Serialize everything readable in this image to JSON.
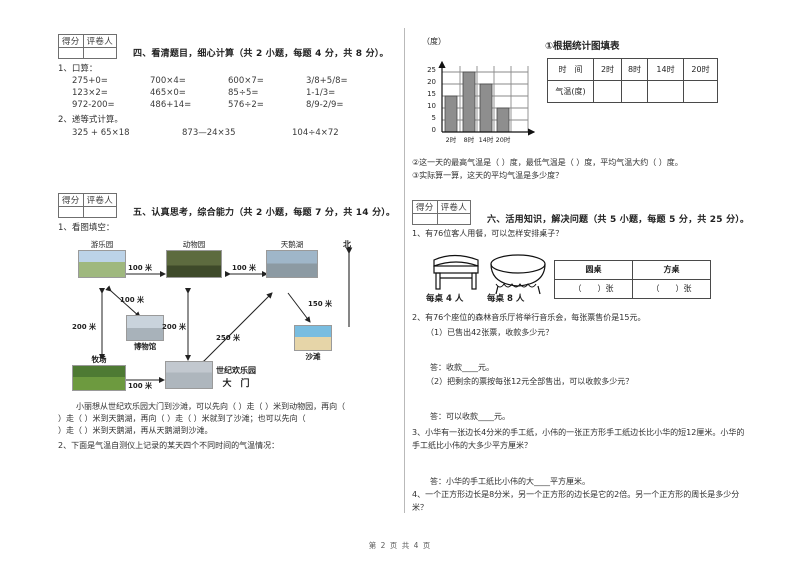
{
  "footer": "第 2 页 共 4 页",
  "score_box": {
    "score_label": "得分",
    "grader_label": "评卷人"
  },
  "section4": {
    "title": "四、看清题目，细心计算（共 2 小题，每题 4 分，共 8 分）。",
    "q1_label": "1、口算：",
    "oral_rows": [
      [
        "275+0=",
        "700×4=",
        "600×7=",
        "3/8+5/8="
      ],
      [
        "123×2=",
        "465×0=",
        "85÷5=",
        "1-1/3="
      ],
      [
        "972-200=",
        "486+14=",
        "576÷2=",
        "8/9-2/9="
      ]
    ],
    "q2_label": "2、递等式计算。",
    "equations": [
      "325 + 65×18",
      "873—24×35",
      "104÷4×72"
    ]
  },
  "section5": {
    "title": "五、认真思考，综合能力（共 2 小题，每题 7 分，共 14 分）。",
    "q1_label": "1、看图填空：",
    "north": "北",
    "map": {
      "nodes": [
        {
          "name": "游乐园"
        },
        {
          "name": "动物园"
        },
        {
          "name": "天鹅湖"
        },
        {
          "name": "博物馆"
        },
        {
          "name": "牧场"
        },
        {
          "name": "世纪欢乐园"
        },
        {
          "name": "大　门"
        },
        {
          "name": "沙滩"
        }
      ],
      "distances": [
        "100 米",
        "100 米",
        "100 米",
        "200 米",
        "200 米",
        "250 米",
        "150 米",
        "100 米"
      ]
    },
    "fill_lines": [
      "小丽想从世纪欢乐园大门到沙滩，可以先向（        ）走（         ）米到动物园，再向（",
      "）走（          ）米到天鹅湖，再向（          ）走（         ）米就到了沙滩；也可以先向（",
      "）走（       ）米到天鹅湖，再从天鹅湖到沙滩。"
    ],
    "q2_label": "2、下面是气温自测仪上记录的某天四个不同时间的气温情况："
  },
  "chart_data": {
    "type": "bar",
    "title": "",
    "unit_label": "（度）",
    "categories": [
      "2时",
      "8时",
      "14时",
      "20时"
    ],
    "values": [
      15,
      25,
      20,
      10
    ],
    "xlabel": "",
    "ylabel": "度",
    "ylim": [
      0,
      25
    ],
    "yticks": [
      0,
      5,
      10,
      15,
      20,
      25
    ],
    "grid": true,
    "legend": "none"
  },
  "chart_section": {
    "table_title": "①根据统计图填表",
    "table_header": [
      "时　间",
      "2时",
      "8时",
      "14时",
      "20时"
    ],
    "table_row_label": "气温(度)",
    "table_row_values": [
      "",
      "",
      "",
      ""
    ],
    "q2_text": "②这一天的最高气温是（      ）度，最低气温是（      ）度，平均气温大约（      ）度。",
    "q3_text": "③实际算一算，这天的平均气温是多少度？"
  },
  "section6": {
    "title": "六、活用知识，解决问题（共 5 小题，每题 5 分，共 25 分）。",
    "q1": {
      "text": "1、有76位客人用餐，可以怎样安排桌子？",
      "sq_table_label": "每桌 4 人",
      "round_table_label": "每桌 8 人",
      "table_header": [
        "圆桌",
        "方桌"
      ],
      "table_cells": [
        "（　　）张",
        "（　　）张"
      ]
    },
    "q2": {
      "text": "2、有76个座位的森林音乐厅将举行音乐会，每张票售价是15元。",
      "part1": "（1）已售出42张票，收款多少元？",
      "ans1": "答：收款____元。",
      "part2": "（2）把剩余的票按每张12元全部售出，可以收款多少元？",
      "ans2": "答：可以收款____元。"
    },
    "q3": {
      "line1": "3、小华有一张边长4分米的手工纸，小伟的一张正方形手工纸边长比小华的短12厘米。小华的",
      "line2": "手工纸比小伟的大多少平方厘米？",
      "ans": "答：小华的手工纸比小伟的大____平方厘米。"
    },
    "q4": {
      "line1": "4、一个正方形边长是8分米，另一个正方形的边长是它的2倍。另一个正方形的周长是多少分",
      "line2": "米？"
    }
  }
}
